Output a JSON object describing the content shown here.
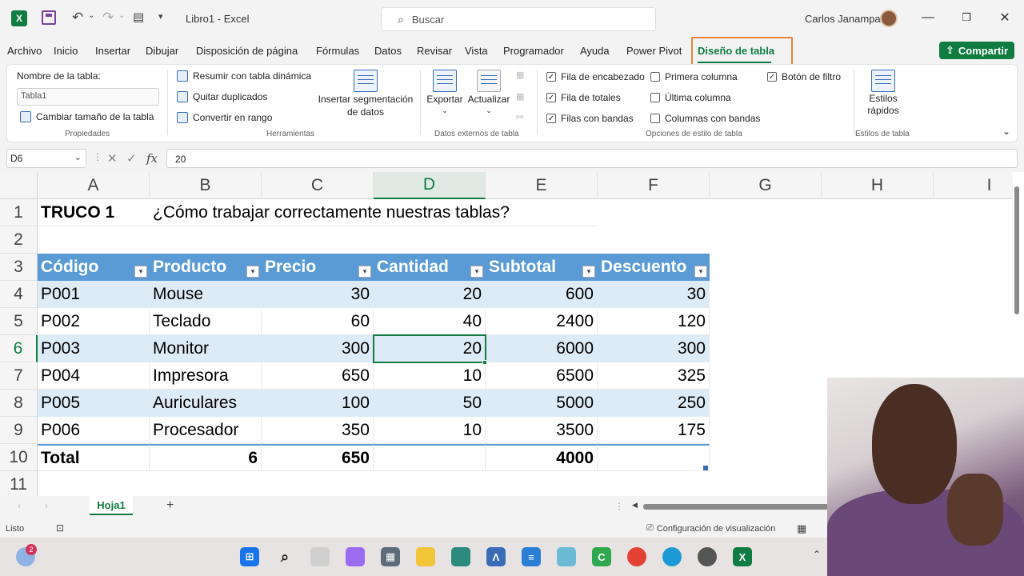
{
  "titlebar": {
    "app_icon": "excel-logo",
    "doc_title": "Libro1 - Excel",
    "search_placeholder": "Buscar",
    "user_name": "Carlos Janampa"
  },
  "menu": {
    "tabs": [
      "Archivo",
      "Inicio",
      "Insertar",
      "Dibujar",
      "Disposición de página",
      "Fórmulas",
      "Datos",
      "Revisar",
      "Vista",
      "Programador",
      "Ayuda",
      "Power Pivot",
      "Diseño de tabla"
    ],
    "active_tab": "Diseño de tabla",
    "share_label": "Compartir"
  },
  "ribbon": {
    "propiedades": {
      "table_name_label": "Nombre de la tabla:",
      "table_name_value": "Tabla1",
      "resize_label": "Cambiar tamaño de la tabla",
      "group_label": "Propiedades"
    },
    "herramientas": {
      "pivot_label": "Resumir con tabla dinámica",
      "remove_dup_label": "Quitar duplicados",
      "convert_label": "Convertir en rango",
      "slicer_label_1": "Insertar segmentación",
      "slicer_label_2": "de datos",
      "group_label": "Herramientas"
    },
    "datos_externos": {
      "export_label": "Exportar",
      "refresh_label": "Actualizar",
      "group_label": "Datos externos de tabla"
    },
    "opciones": {
      "header_row": {
        "label": "Fila de encabezado",
        "checked": true
      },
      "total_row": {
        "label": "Fila de totales",
        "checked": true
      },
      "banded_rows": {
        "label": "Filas con bandas",
        "checked": true
      },
      "first_column": {
        "label": "Primera columna",
        "checked": false
      },
      "last_column": {
        "label": "Última columna",
        "checked": false
      },
      "banded_columns": {
        "label": "Columnas con bandas",
        "checked": false
      },
      "filter_button": {
        "label": "Botón de filtro",
        "checked": true
      },
      "group_label": "Opciones de estilo de tabla"
    },
    "estilos": {
      "quick_styles_1": "Estilos",
      "quick_styles_2": "rápidos",
      "group_label": "Estilos de tabla"
    }
  },
  "formula_bar": {
    "name_box": "D6",
    "formula": "20"
  },
  "grid": {
    "columns": [
      "A",
      "B",
      "C",
      "D",
      "E",
      "F",
      "G",
      "H",
      "I"
    ],
    "rows": [
      "1",
      "2",
      "3",
      "4",
      "5",
      "6",
      "7",
      "8",
      "9",
      "10",
      "11"
    ],
    "selected_column": "D",
    "selected_row": "6",
    "title_cell": "TRUCO 1",
    "subtitle_cell": "¿Cómo trabajar correctamente nuestras tablas?",
    "table_headers": [
      "Código",
      "Producto",
      "Precio",
      "Cantidad",
      "Subtotal",
      "Descuento"
    ],
    "table_rows": [
      [
        "P001",
        "Mouse",
        "30",
        "20",
        "600",
        "30"
      ],
      [
        "P002",
        "Teclado",
        "60",
        "40",
        "2400",
        "120"
      ],
      [
        "P003",
        "Monitor",
        "300",
        "20",
        "6000",
        "300"
      ],
      [
        "P004",
        "Impresora",
        "650",
        "10",
        "6500",
        "325"
      ],
      [
        "P005",
        "Auriculares",
        "100",
        "50",
        "5000",
        "250"
      ],
      [
        "P006",
        "Procesador",
        "350",
        "10",
        "3500",
        "175"
      ]
    ],
    "total_row": [
      "Total",
      "6",
      "650",
      "",
      "4000",
      ""
    ]
  },
  "sheets": {
    "active": "Hoja1"
  },
  "status": {
    "ready": "Listo",
    "display_settings": "Configuración de visualización"
  },
  "taskbar": {
    "weather_badge": "2"
  }
}
